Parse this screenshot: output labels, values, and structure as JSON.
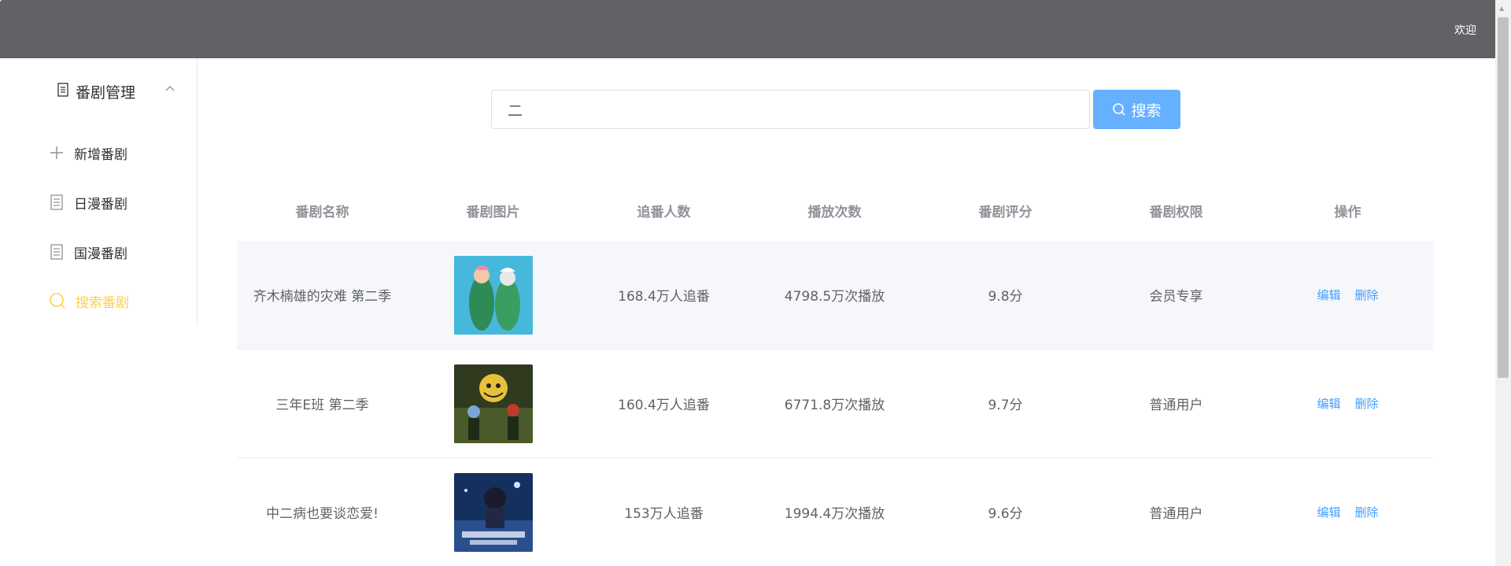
{
  "header": {
    "welcome": "欢迎"
  },
  "sidebar": {
    "group_title": "番剧管理",
    "items": [
      {
        "label": "新增番剧",
        "icon": "plus-icon",
        "active": false
      },
      {
        "label": "日漫番剧",
        "icon": "document-icon",
        "active": false
      },
      {
        "label": "国漫番剧",
        "icon": "document-icon",
        "active": false
      },
      {
        "label": "搜索番剧",
        "icon": "search-icon",
        "active": true
      }
    ]
  },
  "search": {
    "value": "二",
    "button_label": "搜索"
  },
  "table": {
    "columns": [
      "番剧名称",
      "番剧图片",
      "追番人数",
      "播放次数",
      "番剧评分",
      "番剧权限",
      "操作"
    ],
    "rows": [
      {
        "name": "齐木楠雄的灾难 第二季",
        "followers": "168.4万人追番",
        "plays": "4798.5万次播放",
        "score": "9.8分",
        "permission": "会员专享",
        "edit": "编辑",
        "delete": "删除"
      },
      {
        "name": "三年E班 第二季",
        "followers": "160.4万人追番",
        "plays": "6771.8万次播放",
        "score": "9.7分",
        "permission": "普通用户",
        "edit": "编辑",
        "delete": "删除"
      },
      {
        "name": "中二病也要谈恋爱!",
        "followers": "153万人追番",
        "plays": "1994.4万次播放",
        "score": "9.6分",
        "permission": "普通用户",
        "edit": "编辑",
        "delete": "删除"
      }
    ]
  },
  "colors": {
    "header_bg": "#606266",
    "active_menu": "#ffd04b",
    "primary_button": "#66b1ff",
    "link": "#409eff",
    "row_highlight": "#f5f7fa"
  }
}
